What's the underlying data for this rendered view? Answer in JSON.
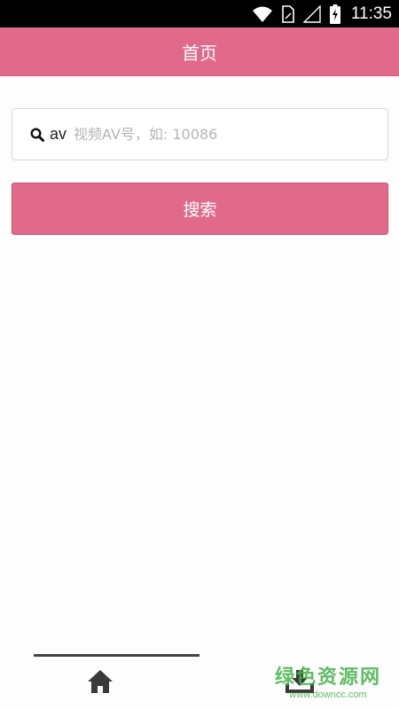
{
  "status_bar": {
    "time": "11:35",
    "icons": [
      "wifi-icon",
      "sim-card-icon",
      "signal-icon",
      "battery-charging-icon"
    ]
  },
  "header": {
    "title": "首页"
  },
  "search": {
    "icon": "search-icon",
    "prefix": "av",
    "value": "",
    "placeholder": "视频AV号，如: 10086"
  },
  "search_button": {
    "label": "搜索"
  },
  "bottom_nav": {
    "active_tab": "home",
    "tabs": [
      {
        "name": "home",
        "icon": "home-icon"
      },
      {
        "name": "download",
        "icon": "download-icon"
      }
    ]
  },
  "watermark": {
    "title": "绿色资源网",
    "url": "www.downcc.com"
  },
  "colors": {
    "accent": "#e16a8b",
    "status_bar": "#000000",
    "background": "#fdfdfd"
  }
}
